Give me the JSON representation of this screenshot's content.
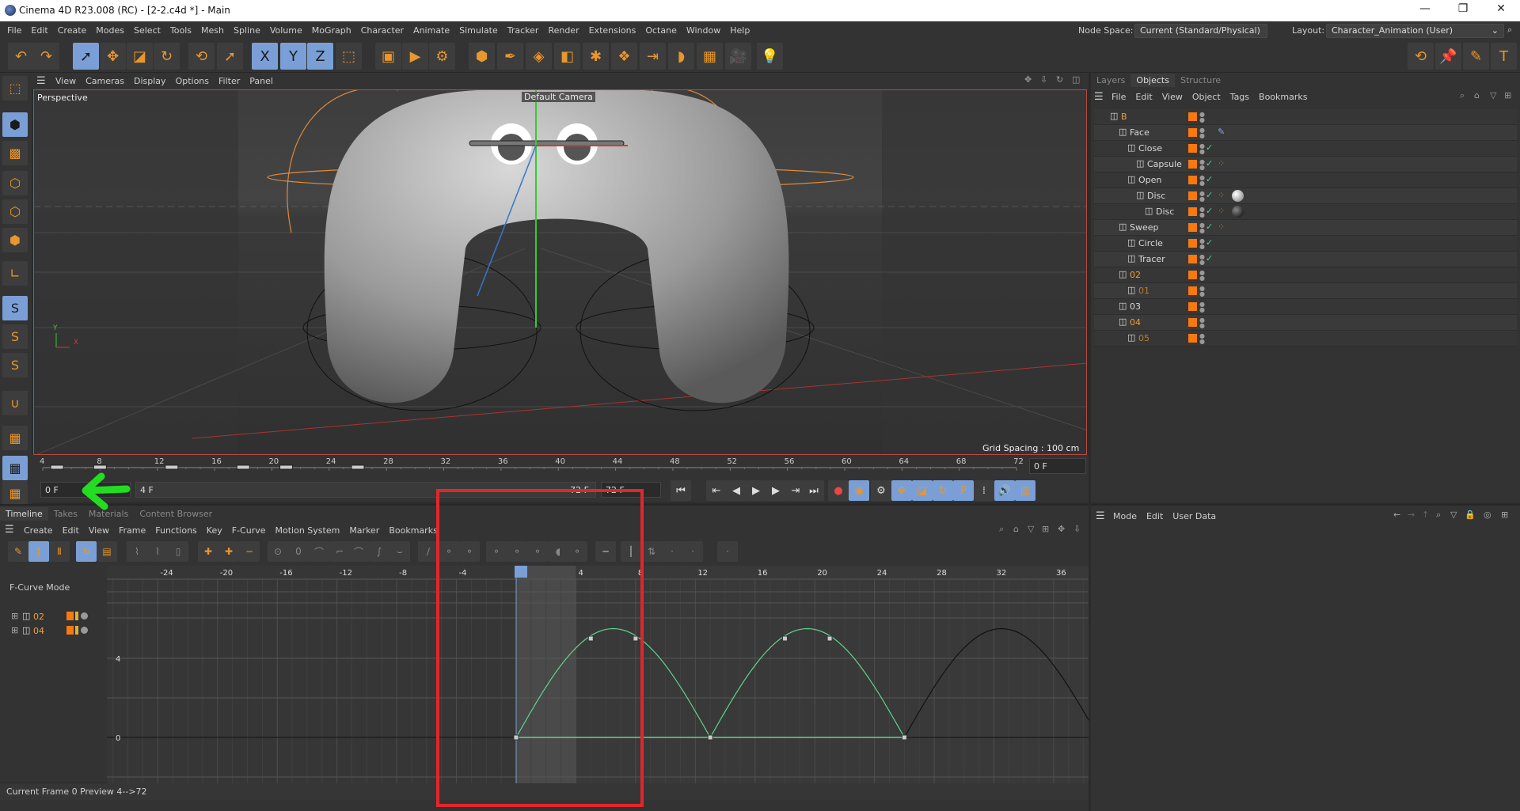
{
  "window": {
    "title": "Cinema 4D R23.008 (RC) - [2-2.c4d *] - Main",
    "minimize": "—",
    "restore": "❐",
    "close": "✕"
  },
  "menubar": {
    "items": [
      "File",
      "Edit",
      "Create",
      "Modes",
      "Select",
      "Tools",
      "Mesh",
      "Spline",
      "Volume",
      "MoGraph",
      "Character",
      "Animate",
      "Simulate",
      "Tracker",
      "Render",
      "Extensions",
      "Octane",
      "Window",
      "Help"
    ],
    "node_space_label": "Node Space:",
    "node_space_value": "Current (Standard/Physical)",
    "layout_label": "Layout:",
    "layout_value": "Character_Animation (User)"
  },
  "toolbar": {
    "icons": [
      {
        "name": "undo-icon",
        "glyph": "↶",
        "on": false
      },
      {
        "name": "redo-icon",
        "glyph": "↷",
        "on": false
      },
      {
        "name": "select-live-icon",
        "glyph": "➚",
        "on": true
      },
      {
        "name": "move-icon",
        "glyph": "✥",
        "on": false
      },
      {
        "name": "scale-icon",
        "glyph": "◪",
        "on": false
      },
      {
        "name": "rotate-icon",
        "glyph": "↻",
        "on": false
      },
      {
        "name": "psr-reset-icon",
        "glyph": "⟲",
        "on": false
      },
      {
        "name": "select-icon",
        "glyph": "➚",
        "on": false
      },
      {
        "name": "x-axis-icon",
        "glyph": "X",
        "on": true
      },
      {
        "name": "y-axis-icon",
        "glyph": "Y",
        "on": true
      },
      {
        "name": "z-axis-icon",
        "glyph": "Z",
        "on": true
      },
      {
        "name": "coordinate-system-icon",
        "glyph": "⬚",
        "on": false
      },
      {
        "name": "render-view-icon",
        "glyph": "▣",
        "on": false
      },
      {
        "name": "render-picture-viewer-icon",
        "glyph": "▶",
        "on": false
      },
      {
        "name": "render-settings-icon",
        "glyph": "⚙",
        "on": false
      },
      {
        "name": "cube-icon",
        "glyph": "⬢",
        "on": false
      },
      {
        "name": "pen-icon",
        "glyph": "✒",
        "on": false
      },
      {
        "name": "subdivision-icon",
        "glyph": "◈",
        "on": false
      },
      {
        "name": "extrude-icon",
        "glyph": "◧",
        "on": false
      },
      {
        "name": "cloner-icon",
        "glyph": "✱",
        "on": false
      },
      {
        "name": "fracture-icon",
        "glyph": "❖",
        "on": false
      },
      {
        "name": "deformer-icon",
        "glyph": "⇥",
        "on": false
      },
      {
        "name": "field-icon",
        "glyph": "◗",
        "on": false
      },
      {
        "name": "floor-icon",
        "glyph": "▦",
        "on": false
      },
      {
        "name": "camera-icon",
        "glyph": "🎥",
        "on": false
      },
      {
        "name": "light-icon",
        "glyph": "💡",
        "on": false
      }
    ],
    "right_icons": [
      {
        "name": "psr-icon",
        "glyph": "⟲"
      },
      {
        "name": "pin-psr-icon",
        "glyph": "📌"
      },
      {
        "name": "sketch-icon",
        "glyph": "✎"
      },
      {
        "name": "text-icon",
        "glyph": "T"
      }
    ]
  },
  "left_toolbar": [
    {
      "name": "make-editable-icon",
      "glyph": "⬚",
      "on": false
    },
    {
      "name": "model-mode-icon",
      "glyph": "⬢",
      "on": true
    },
    {
      "name": "texture-mode-icon",
      "glyph": "▩",
      "on": false
    },
    {
      "name": "points-mode-icon",
      "glyph": "⬡",
      "on": false
    },
    {
      "name": "edges-mode-icon",
      "glyph": "⬡",
      "on": false
    },
    {
      "name": "polygons-mode-icon",
      "glyph": "⬢",
      "on": false
    },
    {
      "name": "axis-mode-icon",
      "glyph": "∟",
      "on": false
    },
    {
      "name": "solo-icon",
      "glyph": "S",
      "on": true
    },
    {
      "name": "solo-selection-icon",
      "glyph": "S",
      "on": false
    },
    {
      "name": "solo-hierarchy-icon",
      "glyph": "S",
      "on": false
    },
    {
      "name": "snap-icon",
      "glyph": "∪",
      "on": false
    },
    {
      "name": "workplane-icon",
      "glyph": "▦",
      "on": false
    },
    {
      "name": "workplane-lock-icon",
      "glyph": "▦",
      "on": true
    },
    {
      "name": "workplane-align-icon",
      "glyph": "▦",
      "on": false
    }
  ],
  "viewport": {
    "menu": [
      "View",
      "Cameras",
      "Display",
      "Options",
      "Filter",
      "Panel"
    ],
    "label": "Perspective",
    "camera": "Default Camera",
    "grid_spacing": "Grid Spacing : 100 cm",
    "axis_x": "X",
    "axis_y": "Y"
  },
  "ruler": {
    "ticks": [
      4,
      8,
      12,
      16,
      20,
      24,
      28,
      32,
      36,
      40,
      44,
      48,
      52,
      56,
      60,
      64,
      68,
      72
    ],
    "current_field": "0 F",
    "keys_at": [
      5,
      8,
      13,
      18,
      21,
      26
    ]
  },
  "transport": {
    "start_field": "0 F",
    "preview_start": "4 F",
    "preview_end": "72 F",
    "end_field": "72 F",
    "buttons": [
      {
        "name": "go-to-start-icon",
        "glyph": "⏮"
      },
      {
        "name": "prev-key-icon",
        "glyph": "⇤"
      },
      {
        "name": "prev-frame-icon",
        "glyph": "◀"
      },
      {
        "name": "play-icon",
        "glyph": "▶"
      },
      {
        "name": "next-frame-icon",
        "glyph": "▶"
      },
      {
        "name": "next-key-icon",
        "glyph": "⇥"
      },
      {
        "name": "go-to-end-icon",
        "glyph": "⏭"
      },
      {
        "name": "record-icon",
        "glyph": "●"
      },
      {
        "name": "autokey-icon",
        "glyph": "◉"
      },
      {
        "name": "keyframe-selection-icon",
        "glyph": "⚙"
      },
      {
        "name": "key-position-icon",
        "glyph": "✥"
      },
      {
        "name": "key-scale-icon",
        "glyph": "◪"
      },
      {
        "name": "key-rotation-icon",
        "glyph": "↻"
      },
      {
        "name": "key-parameter-icon",
        "glyph": "P"
      },
      {
        "name": "key-pla-icon",
        "glyph": "⁞"
      },
      {
        "name": "sound-icon",
        "glyph": "🔊"
      },
      {
        "name": "film-icon",
        "glyph": "▥"
      }
    ]
  },
  "objects_panel": {
    "tabs": [
      "Layers",
      "Objects",
      "Structure"
    ],
    "active_tab": "Objects",
    "menu": [
      "File",
      "Edit",
      "View",
      "Object",
      "Tags",
      "Bookmarks"
    ],
    "items": [
      {
        "name": "B",
        "level": 0,
        "color": "#e8a040",
        "check": false,
        "tags": []
      },
      {
        "name": "Face",
        "level": 1,
        "color": "#d8d8d8",
        "check": false,
        "tags": [
          "psr-tag"
        ]
      },
      {
        "name": "Close",
        "level": 2,
        "color": "#d8d8d8",
        "check": true,
        "tags": []
      },
      {
        "name": "Capsule",
        "level": 3,
        "color": "#d8d8d8",
        "check": true,
        "tags": [
          "material-tag"
        ]
      },
      {
        "name": "Open",
        "level": 2,
        "color": "#d8d8d8",
        "check": true,
        "tags": []
      },
      {
        "name": "Disc",
        "level": 3,
        "color": "#d8d8d8",
        "check": true,
        "tags": [
          "material-tag",
          "white-material"
        ]
      },
      {
        "name": "Disc",
        "level": 4,
        "color": "#d8d8d8",
        "check": true,
        "tags": [
          "material-tag",
          "black-material"
        ]
      },
      {
        "name": "Sweep",
        "level": 1,
        "color": "#d8d8d8",
        "check": true,
        "tags": [
          "material-tag"
        ]
      },
      {
        "name": "Circle",
        "level": 2,
        "color": "#d8d8d8",
        "check": true,
        "tags": []
      },
      {
        "name": "Tracer",
        "level": 2,
        "color": "#d8d8d8",
        "check": true,
        "tags": []
      },
      {
        "name": "02",
        "level": 1,
        "color": "#f0a030",
        "check": false,
        "tags": []
      },
      {
        "name": "01",
        "level": 2,
        "color": "#c07a30",
        "check": false,
        "tags": []
      },
      {
        "name": "03",
        "level": 1,
        "color": "#d8d8d8",
        "check": false,
        "tags": []
      },
      {
        "name": "04",
        "level": 1,
        "color": "#f0a030",
        "check": false,
        "tags": []
      },
      {
        "name": "05",
        "level": 2,
        "color": "#c07a30",
        "check": false,
        "tags": []
      }
    ]
  },
  "attributes": {
    "menu": [
      "Mode",
      "Edit",
      "User Data"
    ]
  },
  "timeline": {
    "tabs": [
      "Timeline",
      "Takes",
      "Materials",
      "Content Browser"
    ],
    "active_tab": "Timeline",
    "menu": [
      "Create",
      "Edit",
      "View",
      "Frame",
      "Functions",
      "Key",
      "F-Curve",
      "Motion System",
      "Marker",
      "Bookmarks"
    ],
    "mode_label": "F-Curve Mode",
    "tracks": [
      {
        "name": "02"
      },
      {
        "name": "04"
      }
    ],
    "frame_ticks": [
      -24,
      -20,
      -16,
      -12,
      -8,
      -4,
      0,
      4,
      8,
      12,
      16,
      20,
      24,
      28,
      32,
      36
    ],
    "value_ticks": [
      0,
      4
    ],
    "current_frame": 0,
    "preview_range": [
      0,
      4
    ],
    "curve_selected": {
      "color": "#5fd38f",
      "keys": [
        [
          0,
          0
        ],
        [
          5,
          5
        ],
        [
          8,
          5
        ],
        [
          13,
          0
        ],
        [
          18,
          5
        ],
        [
          21,
          5
        ],
        [
          26,
          0
        ]
      ],
      "humps": [
        [
          0,
          13
        ],
        [
          13,
          26
        ]
      ],
      "peak": 5.5
    },
    "curve_flat": {
      "color": "#5fd38f",
      "from": 0,
      "to": 26,
      "value": 0
    },
    "curve_unselected": {
      "color": "#111111",
      "humps": [
        [
          26,
          39
        ]
      ],
      "peak": 5.5
    },
    "status": "Current Frame  0  Preview  4-->72"
  },
  "colors": {
    "accent": "#7a9fd6",
    "orange": "#f7790f",
    "annotation_red": "#e2262b",
    "annotation_green": "#22dd22"
  }
}
